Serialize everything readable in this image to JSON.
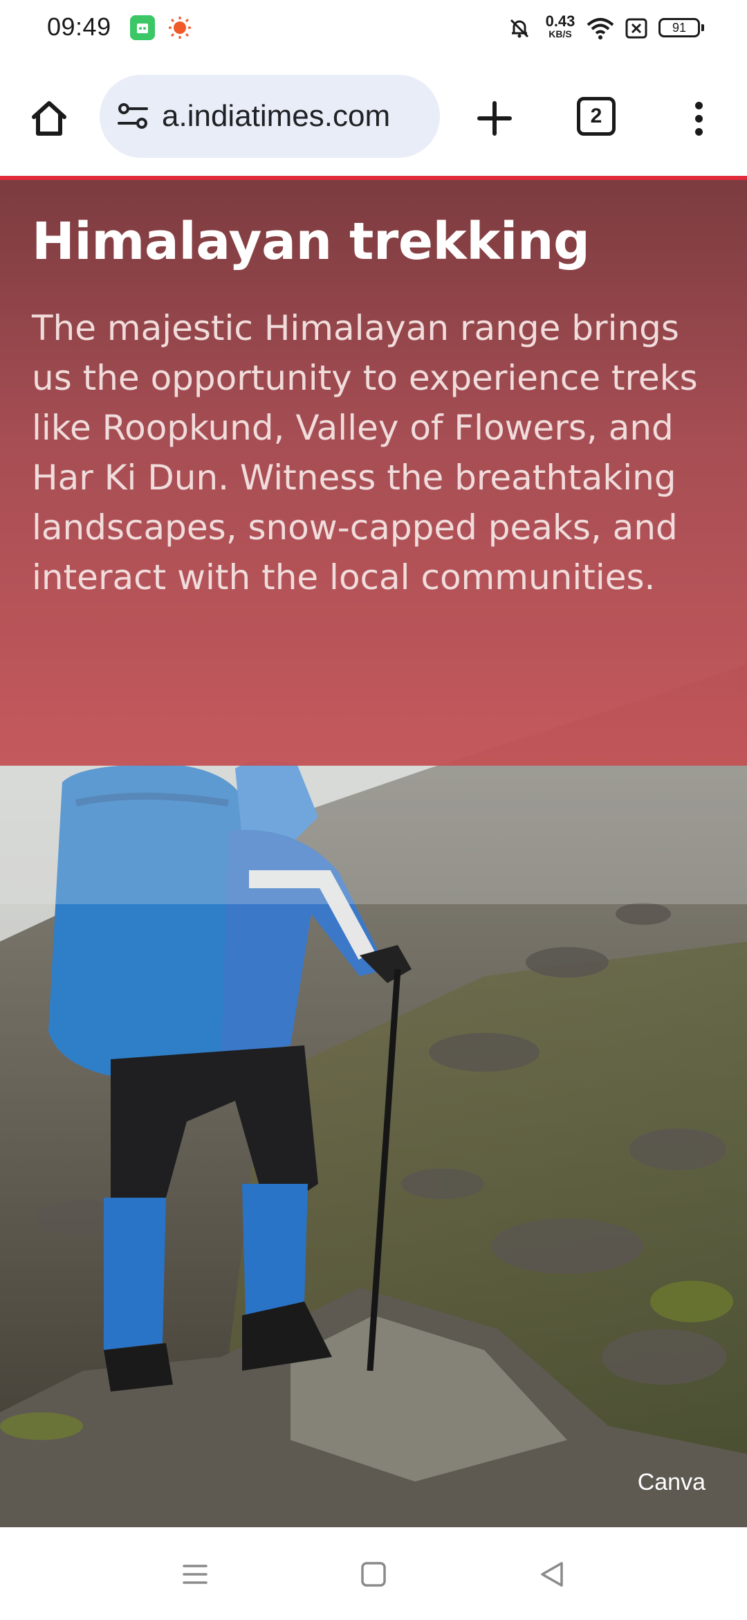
{
  "status_bar": {
    "time": "09:49",
    "net_speed_value": "0.43",
    "net_speed_unit": "KB/S",
    "battery_level": "91",
    "icons": [
      "app-notification-icon",
      "sun-notification-icon",
      "mute-bell-icon",
      "wifi-icon",
      "sim-off-icon",
      "battery-icon"
    ]
  },
  "browser": {
    "url": "a.indiatimes.com",
    "tab_count": "2",
    "icons": [
      "home-icon",
      "site-settings-icon",
      "new-tab-icon",
      "tab-switcher-icon",
      "more-menu-icon"
    ],
    "accent_color": "#e12a3b"
  },
  "article": {
    "title": "Himalayan trekking",
    "body": "The majestic Himalayan range brings us the opportunity to experience treks like Roopkund, Valley of Flowers, and Har Ki Dun. Witness the breathtaking landscapes, snow-capped peaks, and interact with the local communities.",
    "image_credit": "Canva",
    "panel_color": "#a9474d"
  },
  "nav_bar": {
    "icons": [
      "recents-icon",
      "home-square-icon",
      "back-triangle-icon"
    ]
  }
}
